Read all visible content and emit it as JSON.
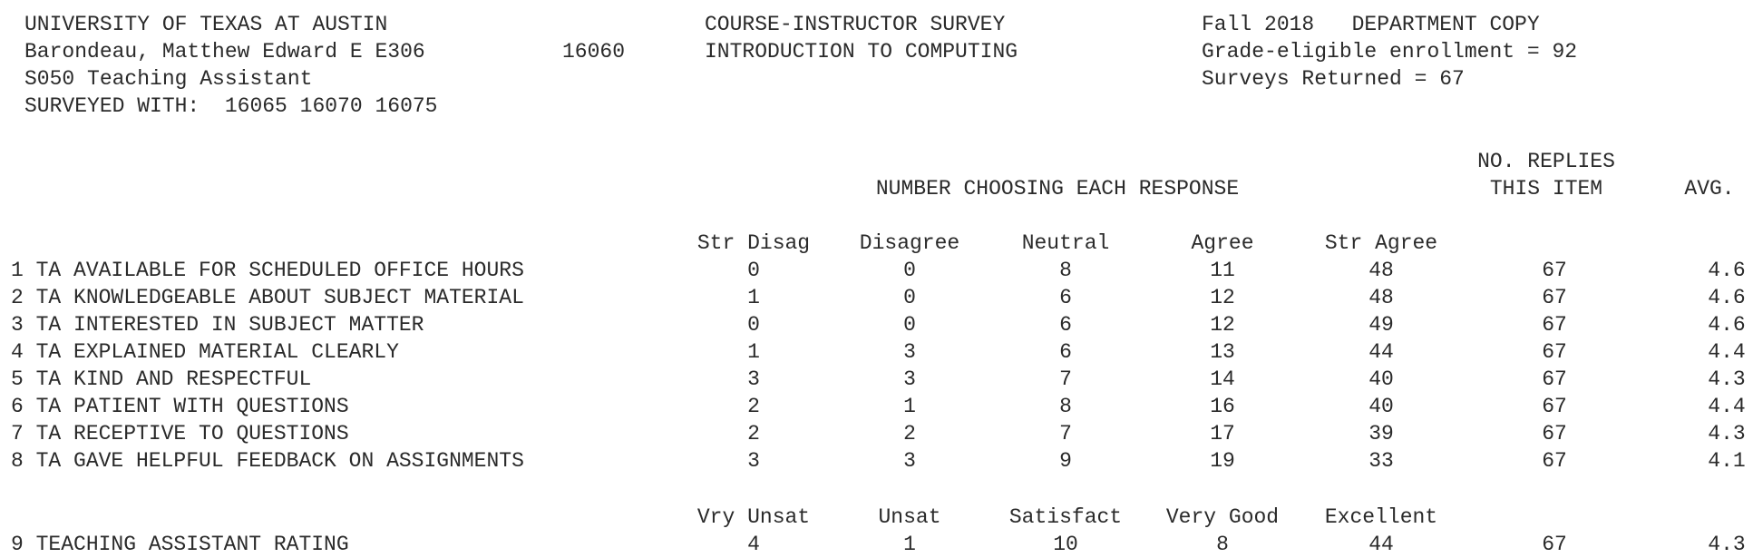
{
  "header": {
    "university": "UNIVERSITY OF TEXAS AT AUSTIN",
    "instructor": "Barondeau, Matthew Edward E E306",
    "unique": "16060",
    "role": "S050 Teaching Assistant",
    "surveyed_with": "SURVEYED WITH:  16065 16070 16075",
    "survey_title": "COURSE-INSTRUCTOR SURVEY",
    "course": "INTRODUCTION TO COMPUTING",
    "term": "Fall 2018   DEPARTMENT COPY",
    "enrollment": "Grade-eligible enrollment = 92",
    "returned": "Surveys Returned = 67"
  },
  "columns": {
    "responses_title": "NUMBER CHOOSING EACH RESPONSE",
    "replies_line1": "NO. REPLIES",
    "replies_line2": "THIS ITEM",
    "avg": "AVG.",
    "scale_a": [
      "Str Disag",
      "Disagree",
      "Neutral",
      "Agree",
      "Str Agree"
    ],
    "scale_b": [
      "Vry Unsat",
      "Unsat",
      "Satisfact",
      "Very Good",
      "Excellent"
    ]
  },
  "rows": [
    {
      "label": "1 TA AVAILABLE FOR SCHEDULED OFFICE HOURS",
      "counts": [
        "0",
        "0",
        "8",
        "11",
        "48"
      ],
      "replies": "67",
      "avg": "4.6"
    },
    {
      "label": "2 TA KNOWLEDGEABLE ABOUT SUBJECT MATERIAL",
      "counts": [
        "1",
        "0",
        "6",
        "12",
        "48"
      ],
      "replies": "67",
      "avg": "4.6"
    },
    {
      "label": "3 TA INTERESTED IN SUBJECT MATTER",
      "counts": [
        "0",
        "0",
        "6",
        "12",
        "49"
      ],
      "replies": "67",
      "avg": "4.6"
    },
    {
      "label": "4 TA EXPLAINED MATERIAL CLEARLY",
      "counts": [
        "1",
        "3",
        "6",
        "13",
        "44"
      ],
      "replies": "67",
      "avg": "4.4"
    },
    {
      "label": "5 TA KIND AND RESPECTFUL",
      "counts": [
        "3",
        "3",
        "7",
        "14",
        "40"
      ],
      "replies": "67",
      "avg": "4.3"
    },
    {
      "label": "6 TA PATIENT WITH QUESTIONS",
      "counts": [
        "2",
        "1",
        "8",
        "16",
        "40"
      ],
      "replies": "67",
      "avg": "4.4"
    },
    {
      "label": "7 TA RECEPTIVE TO QUESTIONS",
      "counts": [
        "2",
        "2",
        "7",
        "17",
        "39"
      ],
      "replies": "67",
      "avg": "4.3"
    },
    {
      "label": "8 TA GAVE HELPFUL FEEDBACK ON ASSIGNMENTS",
      "counts": [
        "3",
        "3",
        "9",
        "19",
        "33"
      ],
      "replies": "67",
      "avg": "4.1"
    }
  ],
  "rating_row": {
    "label": "9 TEACHING ASSISTANT RATING",
    "counts": [
      "4",
      "1",
      "10",
      "8",
      "44"
    ],
    "replies": "67",
    "avg": "4.3"
  }
}
